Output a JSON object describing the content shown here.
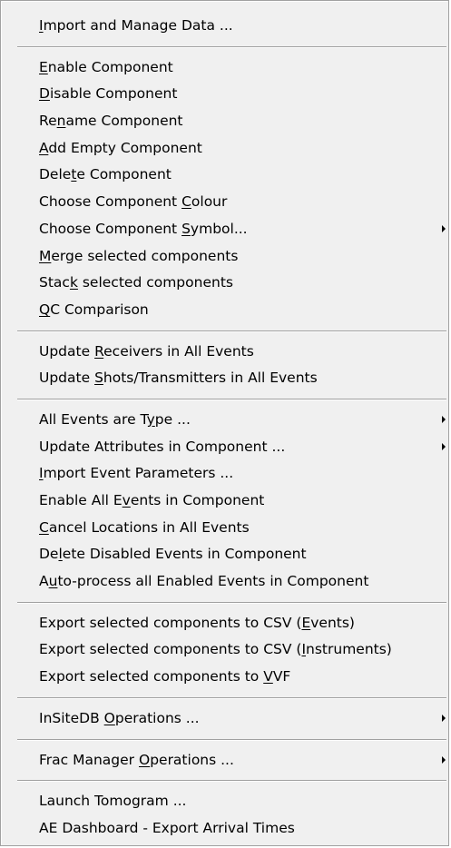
{
  "menu": {
    "groups": [
      {
        "items": [
          {
            "pre": "",
            "key": "I",
            "post": "mport and Manage Data ...",
            "submenu": false
          }
        ]
      },
      {
        "items": [
          {
            "pre": "",
            "key": "E",
            "post": "nable Component",
            "submenu": false
          },
          {
            "pre": "",
            "key": "D",
            "post": "isable Component",
            "submenu": false
          },
          {
            "pre": "Re",
            "key": "n",
            "post": "ame Component",
            "submenu": false
          },
          {
            "pre": "",
            "key": "A",
            "post": "dd Empty Component",
            "submenu": false
          },
          {
            "pre": "Dele",
            "key": "t",
            "post": "e Component",
            "submenu": false
          },
          {
            "pre": "Choose Component ",
            "key": "C",
            "post": "olour",
            "submenu": false
          },
          {
            "pre": "Choose Component ",
            "key": "S",
            "post": "ymbol...",
            "submenu": true
          },
          {
            "pre": "",
            "key": "M",
            "post": "erge selected components",
            "submenu": false
          },
          {
            "pre": "Stac",
            "key": "k",
            "post": " selected components",
            "submenu": false
          },
          {
            "pre": "",
            "key": "Q",
            "post": "C Comparison",
            "submenu": false
          }
        ]
      },
      {
        "items": [
          {
            "pre": "Update ",
            "key": "R",
            "post": "eceivers in All Events",
            "submenu": false
          },
          {
            "pre": "Update ",
            "key": "S",
            "post": "hots/Transmitters in All Events",
            "submenu": false
          }
        ]
      },
      {
        "items": [
          {
            "pre": "All Events are T",
            "key": "y",
            "post": "pe ...",
            "submenu": true
          },
          {
            "pre": "Update Attributes in Component ...",
            "key": "",
            "post": "",
            "submenu": true
          },
          {
            "pre": "",
            "key": "I",
            "post": "mport Event Parameters ...",
            "submenu": false
          },
          {
            "pre": "Enable All E",
            "key": "v",
            "post": "ents in Component",
            "submenu": false
          },
          {
            "pre": "",
            "key": "C",
            "post": "ancel Locations in All Events",
            "submenu": false
          },
          {
            "pre": "De",
            "key": "l",
            "post": "ete Disabled Events in Component",
            "submenu": false
          },
          {
            "pre": "A",
            "key": "u",
            "post": "to-process all Enabled Events in Component",
            "submenu": false
          }
        ]
      },
      {
        "items": [
          {
            "pre": "Export selected components to CSV (",
            "key": "E",
            "post": "vents)",
            "submenu": false
          },
          {
            "pre": "Export selected components to CSV (",
            "key": "I",
            "post": "nstruments)",
            "submenu": false
          },
          {
            "pre": "Export selected components to ",
            "key": "V",
            "post": "VF",
            "submenu": false
          }
        ]
      },
      {
        "items": [
          {
            "pre": "InSiteDB ",
            "key": "O",
            "post": "perations ...",
            "submenu": true
          }
        ]
      },
      {
        "items": [
          {
            "pre": "Frac Manager ",
            "key": "O",
            "post": "perations ...",
            "submenu": true
          }
        ]
      },
      {
        "items": [
          {
            "pre": "Launch Tomogram ...",
            "key": "",
            "post": "",
            "submenu": false
          },
          {
            "pre": "AE Dashboard - Export Arrival Times",
            "key": "",
            "post": "",
            "submenu": false
          }
        ]
      }
    ]
  }
}
